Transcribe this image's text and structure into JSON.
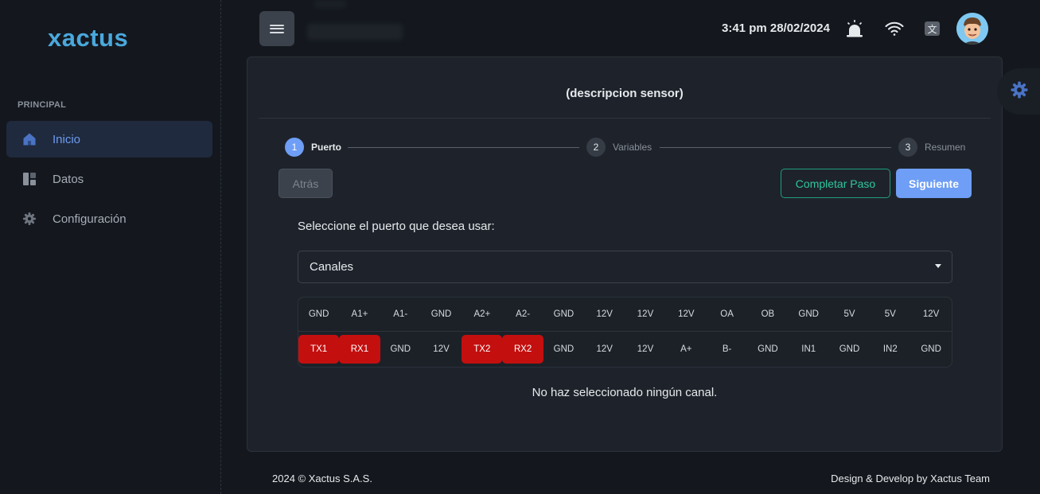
{
  "sidebar": {
    "logo": "xactus",
    "section_label": "PRINCIPAL",
    "items": [
      {
        "label": "Inicio",
        "icon": "home-icon"
      },
      {
        "label": "Datos",
        "icon": "dashboard-icon"
      },
      {
        "label": "Configuración",
        "icon": "gear-icon"
      }
    ]
  },
  "header": {
    "datetime": "3:41 pm 28/02/2024",
    "icons": [
      "alarm-icon",
      "wifi-icon",
      "translate-icon",
      "avatar"
    ]
  },
  "card": {
    "title": "(descripcion sensor)",
    "steps": [
      {
        "num": "1",
        "label": "Puerto"
      },
      {
        "num": "2",
        "label": "Variables"
      },
      {
        "num": "3",
        "label": "Resumen"
      }
    ],
    "back_label": "Atrás",
    "complete_label": "Completar Paso",
    "next_label": "Siguiente",
    "prompt": "Seleccione el puerto que desea usar:",
    "select_value": "Canales",
    "pins_top": [
      "GND",
      "A1+",
      "A1-",
      "GND",
      "A2+",
      "A2-",
      "GND",
      "12V",
      "12V",
      "12V",
      "OA",
      "OB",
      "GND",
      "5V",
      "5V",
      "12V"
    ],
    "pins_bottom": [
      "TX1",
      "RX1",
      "GND",
      "12V",
      "TX2",
      "RX2",
      "GND",
      "12V",
      "12V",
      "A+",
      "B-",
      "GND",
      "IN1",
      "GND",
      "IN2",
      "GND"
    ],
    "highlighted_pins": [
      "TX1",
      "RX1",
      "TX2",
      "RX2"
    ],
    "status_message": "No haz seleccionado ningún canal."
  },
  "footer": {
    "left": "2024 © Xactus S.A.S.",
    "right": "Design & Develop by Xactus Team"
  },
  "colors": {
    "accent": "#6e9ef5",
    "success": "#2ec79e",
    "pin_highlight": "#c40f0f",
    "logo": "#4aa8dc"
  }
}
